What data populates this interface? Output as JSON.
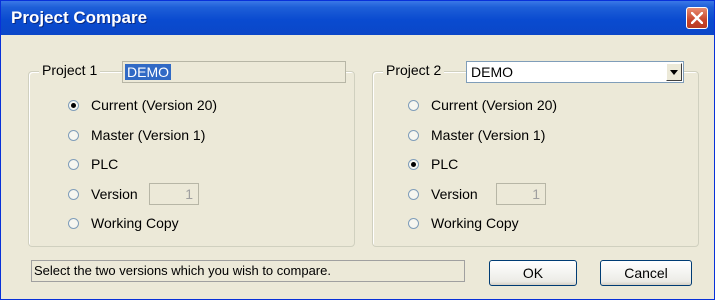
{
  "window": {
    "title": "Project Compare",
    "close_icon": "close-icon"
  },
  "project1": {
    "label": "Project 1",
    "name": "DEMO",
    "options": [
      {
        "label": "Current (Version 20)",
        "checked": true
      },
      {
        "label": "Master (Version 1)",
        "checked": false
      },
      {
        "label": "PLC",
        "checked": false
      },
      {
        "label": "Version",
        "checked": false
      },
      {
        "label": "Working Copy",
        "checked": false
      }
    ],
    "version_value": "1"
  },
  "project2": {
    "label": "Project 2",
    "selected": "DEMO",
    "options": [
      {
        "label": "Current (Version 20)",
        "checked": false
      },
      {
        "label": "Master (Version 1)",
        "checked": false
      },
      {
        "label": "PLC",
        "checked": true
      },
      {
        "label": "Version",
        "checked": false
      },
      {
        "label": "Working Copy",
        "checked": false
      }
    ],
    "version_value": "1"
  },
  "status_text": "Select the two versions which you wish to compare.",
  "buttons": {
    "ok": "OK",
    "cancel": "Cancel"
  },
  "colors": {
    "titlebar": "#0a4bd0",
    "dialog_bg": "#ece9d8",
    "selection": "#316ac5"
  }
}
